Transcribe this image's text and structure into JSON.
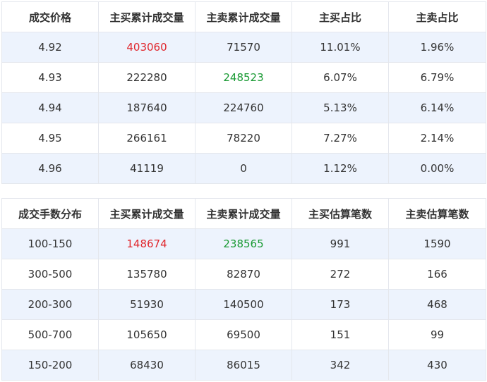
{
  "price_table": {
    "headers": [
      "成交价格",
      "主买累计成交量",
      "主卖累计成交量",
      "主买占比",
      "主卖占比"
    ],
    "rows": [
      [
        "4.92",
        "403060",
        "71570",
        "11.01%",
        "1.96%"
      ],
      [
        "4.93",
        "222280",
        "248523",
        "6.07%",
        "6.79%"
      ],
      [
        "4.94",
        "187640",
        "224760",
        "5.13%",
        "6.14%"
      ],
      [
        "4.95",
        "266161",
        "78220",
        "7.27%",
        "2.14%"
      ],
      [
        "4.96",
        "41119",
        "0",
        "1.12%",
        "0.00%"
      ]
    ]
  },
  "lots_table": {
    "headers": [
      "成交手数分布",
      "主买累计成交量",
      "主卖累计成交量",
      "主买估算笔数",
      "主卖估算笔数"
    ],
    "rows": [
      [
        "100-150",
        "148674",
        "238565",
        "991",
        "1590"
      ],
      [
        "300-500",
        "135780",
        "82870",
        "272",
        "166"
      ],
      [
        "200-300",
        "51930",
        "140500",
        "173",
        "468"
      ],
      [
        "500-700",
        "105650",
        "69500",
        "151",
        "99"
      ],
      [
        "150-200",
        "68430",
        "86015",
        "342",
        "430"
      ]
    ]
  },
  "colors": {
    "highlight_max_buy": "#e0262c",
    "highlight_max_sell": "#1a9a34",
    "stripe": "#edf3fd",
    "border": "#e4e7ed"
  }
}
